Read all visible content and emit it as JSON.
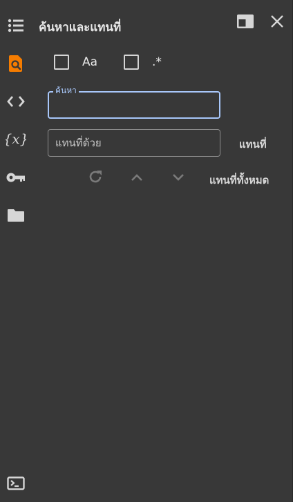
{
  "header": {
    "title": "ค้นหาและแทนที่"
  },
  "options": {
    "match_case_label": "Aa",
    "regex_label": ".*"
  },
  "search": {
    "label": "ค้นหา",
    "value": ""
  },
  "replace": {
    "placeholder": "แทนที่ด้วย",
    "value": "",
    "replace_label": "แทนที่",
    "replace_all_label": "แทนที่ทั้งหมด"
  },
  "icons": {
    "rail": [
      "table-of-contents-icon",
      "find-replace-icon",
      "code-snippets-icon",
      "variables-icon",
      "secrets-key-icon",
      "files-folder-icon",
      "terminal-icon"
    ],
    "header": [
      "dock-panel-icon",
      "close-icon"
    ],
    "toolbar": [
      "refresh-icon",
      "chevron-up-icon",
      "chevron-down-icon"
    ]
  },
  "colors": {
    "background": "#383838",
    "active_icon": "#f57c00",
    "focus_border": "#a8c7fa",
    "text": "#e8e8e8"
  }
}
